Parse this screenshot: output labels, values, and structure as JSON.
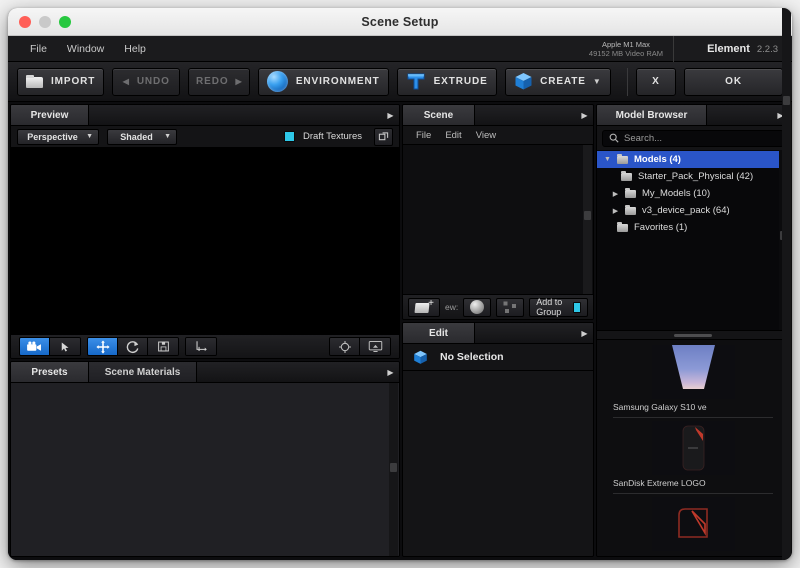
{
  "window": {
    "title": "Scene Setup",
    "traffic_lights": [
      "close",
      "minimize",
      "maximize"
    ]
  },
  "menubar": {
    "items": [
      "File",
      "Window",
      "Help"
    ],
    "system_info_line1": "Apple M1 Max",
    "system_info_line2": "49152 MB Video RAM",
    "brand_name": "Element",
    "brand_version": "2.2.3"
  },
  "toolbar": {
    "import_label": "IMPORT",
    "undo_label": "UNDO",
    "redo_label": "REDO",
    "environment_label": "ENVIRONMENT",
    "extrude_label": "EXTRUDE",
    "create_label": "CREATE",
    "close_label": "X",
    "ok_label": "OK"
  },
  "preview": {
    "tab_label": "Preview",
    "projection": "Perspective",
    "shading": "Shaded",
    "draft_textures_label": "Draft Textures",
    "draft_textures_checked": true,
    "manipulators": [
      {
        "name": "camera-tool",
        "active": true
      },
      {
        "name": "select-tool",
        "active": false
      },
      {
        "name": "move-tool",
        "active": true
      },
      {
        "name": "rotate-tool",
        "active": false
      },
      {
        "name": "scale-tool",
        "active": false
      },
      {
        "name": "axis-tool",
        "active": false
      }
    ],
    "view_tools": [
      {
        "name": "recenter-tool"
      },
      {
        "name": "render-view-tool"
      }
    ]
  },
  "presets": {
    "tabs": [
      {
        "label": "Presets",
        "active": true
      },
      {
        "label": "Scene Materials",
        "active": false
      }
    ]
  },
  "scene": {
    "tab_label": "Scene",
    "menu": [
      "File",
      "Edit",
      "View"
    ],
    "new_label": "ew:",
    "add_to_group_label": "Add to Group",
    "add_to_group_checked": true
  },
  "edit": {
    "tab_label": "Edit",
    "selection_label": "No Selection"
  },
  "model_browser": {
    "tab_label": "Model Browser",
    "search_placeholder": "Search...",
    "search_value": "",
    "tree": [
      {
        "label": "Models (4)",
        "depth": 0,
        "twisty": "down",
        "selected": true
      },
      {
        "label": "Starter_Pack_Physical (42)",
        "depth": 1,
        "twisty": "none",
        "selected": false
      },
      {
        "label": "My_Models (10)",
        "depth": 1,
        "twisty": "right",
        "selected": false
      },
      {
        "label": "v3_device_pack (64)",
        "depth": 1,
        "twisty": "right",
        "selected": false
      },
      {
        "label": "Favorites (1)",
        "depth": 0,
        "twisty": "none",
        "selected": false
      }
    ],
    "thumbnails": [
      {
        "caption": "Samsung Galaxy S10 ve",
        "style": "phone-screen"
      },
      {
        "caption": "SanDisk Extreme LOGO",
        "style": "ssd-dark"
      },
      {
        "caption": "",
        "style": "ssd-outline"
      }
    ]
  },
  "colors": {
    "accent_blue": "#2a55c8",
    "tool_active": "#2478d8",
    "checkbox_cyan": "#2ec8e8",
    "panel_bg": "#141416",
    "viewport_bg": "#000000"
  }
}
